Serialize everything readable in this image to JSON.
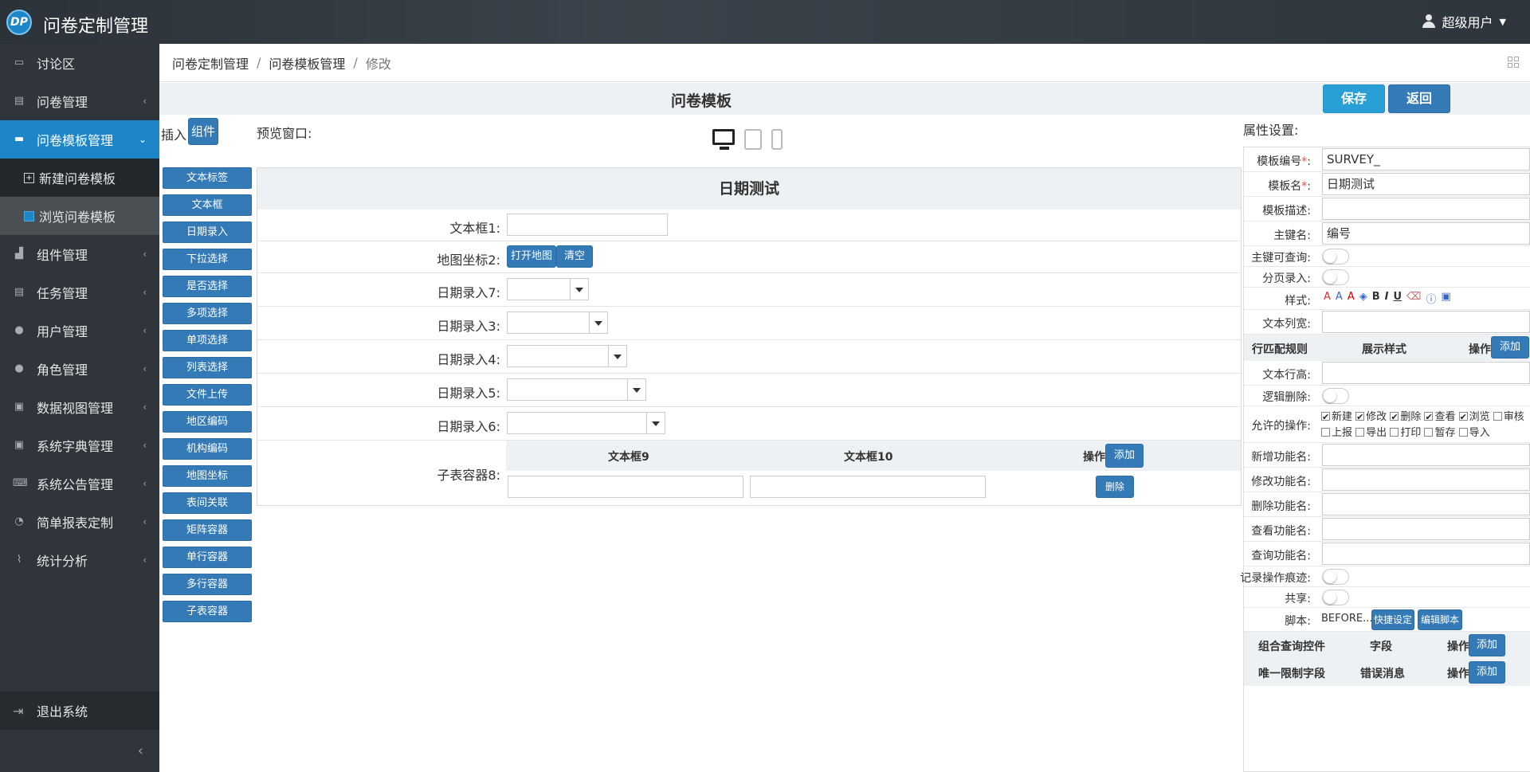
{
  "app": {
    "title": "问卷定制管理",
    "logo": "DP",
    "user": "超级用户"
  },
  "sidebar": {
    "items": [
      {
        "label": "讨论区",
        "icon": "chat-icon"
      },
      {
        "label": "问卷管理",
        "icon": "survey-icon"
      },
      {
        "label": "问卷模板管理",
        "icon": "template-icon"
      },
      {
        "label": "新建问卷模板",
        "icon": "plus-square-icon"
      },
      {
        "label": "浏览问卷模板",
        "icon": "list-square-icon"
      },
      {
        "label": "组件管理",
        "icon": "components-icon"
      },
      {
        "label": "任务管理",
        "icon": "tasks-icon"
      },
      {
        "label": "用户管理",
        "icon": "users-icon"
      },
      {
        "label": "角色管理",
        "icon": "role-icon"
      },
      {
        "label": "数据视图管理",
        "icon": "dataview-icon"
      },
      {
        "label": "系统字典管理",
        "icon": "dictionary-icon"
      },
      {
        "label": "系统公告管理",
        "icon": "keyboard-icon"
      },
      {
        "label": "简单报表定制",
        "icon": "pie-chart-icon"
      },
      {
        "label": "统计分析",
        "icon": "line-chart-icon"
      }
    ],
    "logout": "退出系统"
  },
  "breadcrumb": [
    "问卷定制管理",
    "问卷模板管理",
    "修改"
  ],
  "editor": {
    "title": "问卷模板",
    "save": "保存",
    "back": "返回",
    "insert_label": "插入",
    "component_btn": "组件",
    "preview_label": "预览窗口:"
  },
  "components": [
    "文本标签",
    "文本框",
    "日期录入",
    "下拉选择",
    "是否选择",
    "多项选择",
    "单项选择",
    "列表选择",
    "文件上传",
    "地区编码",
    "机构编码",
    "地图坐标",
    "表间关联",
    "矩阵容器",
    "单行容器",
    "多行容器",
    "子表容器"
  ],
  "form": {
    "title": "日期测试",
    "text1": "文本框1:",
    "map": "地图坐标2:",
    "open_map": "打开地图",
    "clear": "清空",
    "date7": "日期录入7:",
    "date3": "日期录入3:",
    "date4": "日期录入4:",
    "date5": "日期录入5:",
    "date6": "日期录入6:",
    "sub": "子表容器8:",
    "sub_col1": "文本框9",
    "sub_col2": "文本框10",
    "sub_ops": "操作",
    "sub_add": "添加",
    "sub_delete": "删除"
  },
  "props": {
    "title": "属性设置:",
    "template_no_label": "模板编号",
    "template_no": "SURVEY_",
    "template_name_label": "模板名",
    "template_name": "日期测试",
    "desc_label": "模板描述:",
    "pk_label": "主键名:",
    "pk": "编号",
    "pk_query_label": "主键可查询:",
    "paging_label": "分页录入:",
    "style_label": "样式:",
    "col_width_label": "文本列宽:",
    "match_head": "行匹配规则",
    "display_head": "展示样式",
    "ops_head": "操作",
    "add": "添加",
    "row_height_label": "文本行高:",
    "logic_delete_label": "逻辑删除:",
    "allowed_ops_label": "允许的操作:",
    "ops": [
      {
        "label": "新建",
        "on": true
      },
      {
        "label": "修改",
        "on": true
      },
      {
        "label": "删除",
        "on": true
      },
      {
        "label": "查看",
        "on": true
      },
      {
        "label": "浏览",
        "on": true
      },
      {
        "label": "审核",
        "on": false
      },
      {
        "label": "上报",
        "on": false
      },
      {
        "label": "导出",
        "on": false
      },
      {
        "label": "打印",
        "on": false
      },
      {
        "label": "暂存",
        "on": false
      },
      {
        "label": "导入",
        "on": false
      }
    ],
    "add_fn_label": "新增功能名:",
    "edit_fn_label": "修改功能名:",
    "del_fn_label": "删除功能名:",
    "view_fn_label": "查看功能名:",
    "query_fn_label": "查询功能名:",
    "record_trace_label": "记录操作痕迹:",
    "share_label": "共享:",
    "script_label": "脚本:",
    "script_value": "BEFORE...",
    "quick_set": "快捷设定",
    "edit_script": "编辑脚本",
    "combo_head": "组合查询控件",
    "field_head": "字段",
    "unique_head": "唯一限制字段",
    "error_head": "错误消息"
  }
}
